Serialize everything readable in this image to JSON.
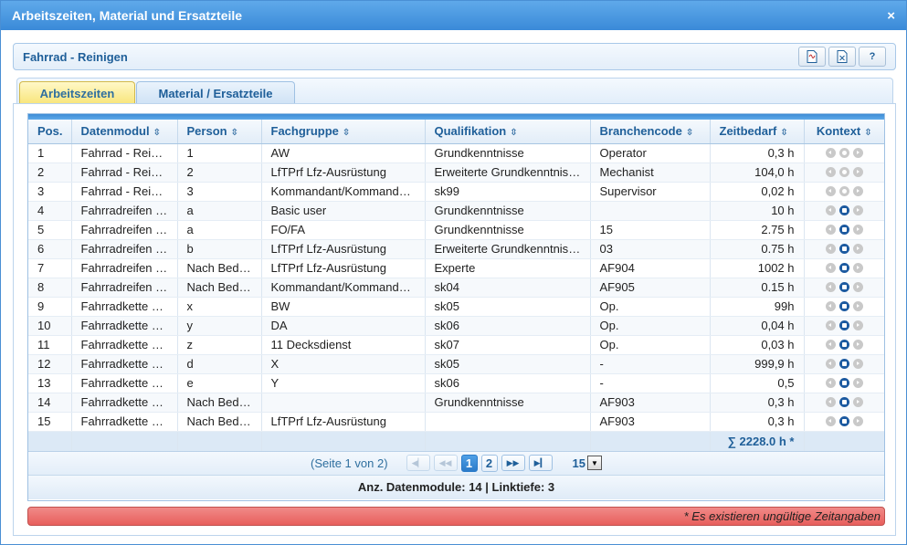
{
  "window": {
    "title": "Arbeitszeiten, Material und Ersatzteile",
    "close_label": "×"
  },
  "header": {
    "title": "Fahrrad - Reinigen",
    "help_label": "?"
  },
  "tabs": [
    {
      "label": "Arbeitszeiten",
      "active": true
    },
    {
      "label": "Material / Ersatzteile",
      "active": false
    }
  ],
  "grid": {
    "columns": [
      "Pos.",
      "Datenmodul",
      "Person",
      "Fachgruppe",
      "Qualifikation",
      "Branchencode",
      "Zeitbedarf",
      "Kontext"
    ],
    "rows": [
      {
        "pos": "1",
        "datenmodul": "Fahrrad - Reinigen",
        "person": "1",
        "fachgruppe": "AW",
        "qualifikation": "Grundkenntnisse",
        "branchencode": "Operator",
        "zeitbedarf": "0,3 h",
        "ctx_active": false
      },
      {
        "pos": "2",
        "datenmodul": "Fahrrad - Reinigen",
        "person": "2",
        "fachgruppe": "LfTPrf Lfz-Ausrüstung",
        "qualifikation": "Erweiterte Grundkenntnisse",
        "branchencode": "Mechanist",
        "zeitbedarf": "104,0 h",
        "ctx_active": false
      },
      {
        "pos": "3",
        "datenmodul": "Fahrrad - Reinigen",
        "person": "3",
        "fachgruppe": "Kommandant/Kommandeur",
        "qualifikation": "sk99",
        "branchencode": "Supervisor",
        "zeitbedarf": "0,02 h",
        "ctx_active": false
      },
      {
        "pos": "4",
        "datenmodul": "Fahrradreifen wechseln",
        "person": "a",
        "fachgruppe": "Basic user",
        "qualifikation": "Grundkenntnisse",
        "branchencode": "",
        "zeitbedarf": "10 h",
        "ctx_active": true
      },
      {
        "pos": "5",
        "datenmodul": "Fahrradreifen wechseln",
        "person": "a",
        "fachgruppe": "FO/FA",
        "qualifikation": "Grundkenntnisse",
        "branchencode": "15",
        "zeitbedarf": "2.75 h",
        "ctx_active": true
      },
      {
        "pos": "6",
        "datenmodul": "Fahrradreifen wechseln",
        "person": "b",
        "fachgruppe": "LfTPrf Lfz-Ausrüstung",
        "qualifikation": "Erweiterte Grundkenntnisse",
        "branchencode": "03",
        "zeitbedarf": "0.75 h",
        "ctx_active": true
      },
      {
        "pos": "7",
        "datenmodul": "Fahrradreifen wechseln",
        "person": "Nach Bedarf",
        "fachgruppe": "LfTPrf Lfz-Ausrüstung",
        "qualifikation": "Experte",
        "branchencode": "AF904",
        "zeitbedarf": "1002 h",
        "ctx_active": true
      },
      {
        "pos": "8",
        "datenmodul": "Fahrradreifen wechseln",
        "person": "Nach Bedarf",
        "fachgruppe": "Kommandant/Kommandeur",
        "qualifikation": "sk04",
        "branchencode": "AF905",
        "zeitbedarf": "0.15 h",
        "ctx_active": true
      },
      {
        "pos": "9",
        "datenmodul": "Fahrradkette ölen",
        "person": "x",
        "fachgruppe": "BW",
        "qualifikation": "sk05",
        "branchencode": "Op.",
        "zeitbedarf": "99h",
        "ctx_active": true
      },
      {
        "pos": "10",
        "datenmodul": "Fahrradkette ölen",
        "person": "y",
        "fachgruppe": "DA",
        "qualifikation": "sk06",
        "branchencode": "Op.",
        "zeitbedarf": "0,04 h",
        "ctx_active": true
      },
      {
        "pos": "11",
        "datenmodul": "Fahrradkette ölen",
        "person": "z",
        "fachgruppe": "11 Decksdienst",
        "qualifikation": "sk07",
        "branchencode": "Op.",
        "zeitbedarf": "0,03 h",
        "ctx_active": true
      },
      {
        "pos": "12",
        "datenmodul": "Fahrradkette ölen",
        "person": "d",
        "fachgruppe": "X",
        "qualifikation": "sk05",
        "branchencode": "-",
        "zeitbedarf": "999,9 h",
        "ctx_active": true
      },
      {
        "pos": "13",
        "datenmodul": "Fahrradkette ölen",
        "person": "e",
        "fachgruppe": "Y",
        "qualifikation": "sk06",
        "branchencode": "-",
        "zeitbedarf": "0,5",
        "ctx_active": true
      },
      {
        "pos": "14",
        "datenmodul": "Fahrradkette ölen",
        "person": "Nach Bedarf",
        "fachgruppe": "",
        "qualifikation": "Grundkenntnisse",
        "branchencode": "AF903",
        "zeitbedarf": "0,3 h",
        "ctx_active": true
      },
      {
        "pos": "15",
        "datenmodul": "Fahrradkette ölen",
        "person": "Nach Bedarf",
        "fachgruppe": "LfTPrf Lfz-Ausrüstung",
        "qualifikation": "",
        "branchencode": "AF903",
        "zeitbedarf": "0,3 h",
        "ctx_active": true
      }
    ],
    "sum": "∑ 2228.0 h *"
  },
  "pager": {
    "info": "(Seite 1 von 2)",
    "pages": [
      "1",
      "2"
    ],
    "current_page": "1",
    "page_size": "15"
  },
  "footer": {
    "info": "Anz. Datenmodule: 14 | Linktiefe: 3"
  },
  "warning": {
    "text": "* Es existieren ungültige Zeitangaben"
  },
  "colors": {
    "accent": "#3a8ad8",
    "warning": "#e85f5c",
    "active_tab": "#f8e57a"
  }
}
